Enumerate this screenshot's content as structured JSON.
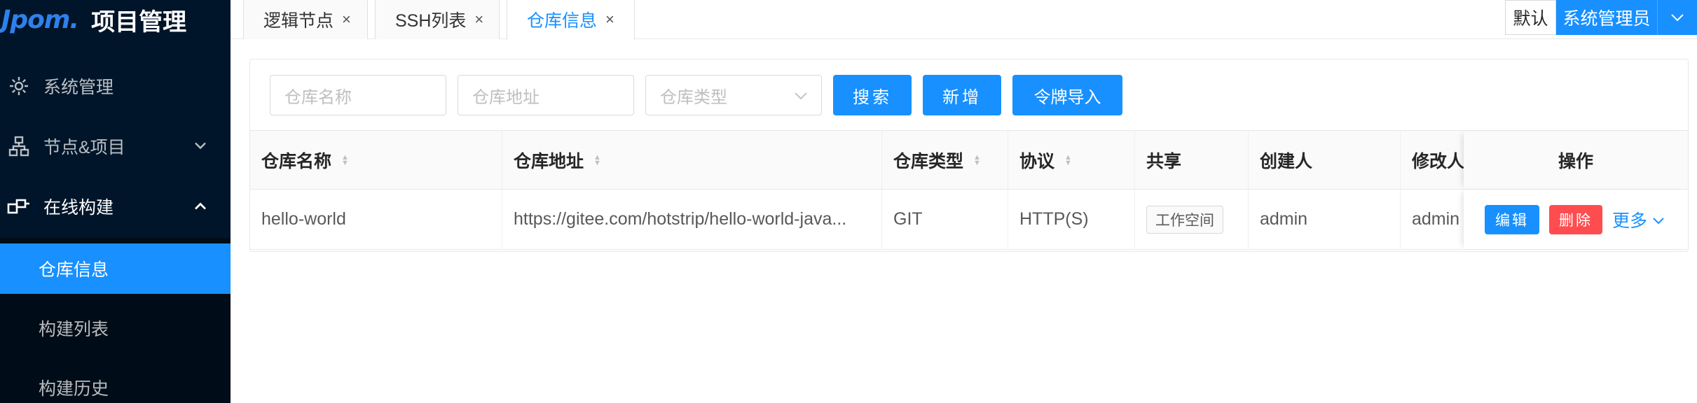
{
  "app": {
    "logo": "Jpom.",
    "title": "项目管理"
  },
  "sidebar": {
    "menu": [
      {
        "label": "系统管理",
        "icon": "gear-icon"
      },
      {
        "label": "节点&项目",
        "icon": "sitemap-icon",
        "arrow": "chevron-down-icon"
      },
      {
        "label": "在线构建",
        "icon": "build-icon",
        "arrow": "chevron-up-icon"
      }
    ],
    "submenu": [
      {
        "label": "仓库信息",
        "active": true
      },
      {
        "label": "构建列表"
      },
      {
        "label": "构建历史"
      }
    ]
  },
  "tabs": [
    {
      "label": "逻辑节点",
      "close": "×"
    },
    {
      "label": "SSH列表",
      "close": "×"
    },
    {
      "label": "仓库信息",
      "close": "×",
      "active": true
    }
  ],
  "user": {
    "workspace": "默认",
    "name": "系统管理员",
    "dropdown": "∨"
  },
  "filters": {
    "name_placeholder": "仓库名称",
    "url_placeholder": "仓库地址",
    "type_placeholder": "仓库类型",
    "search_label": "搜索",
    "add_label": "新增",
    "import_label": "令牌导入"
  },
  "table": {
    "columns": [
      "仓库名称",
      "仓库地址",
      "仓库类型",
      "协议",
      "共享",
      "创建人",
      "修改人",
      "操作"
    ],
    "rows": [
      {
        "name": "hello-world",
        "url": "https://gitee.com/hotstrip/hello-world-java...",
        "type": "GIT",
        "protocol": "HTTP(S)",
        "share": "工作空间",
        "creator": "admin",
        "modifier": "admin",
        "edit": "编辑",
        "delete": "删除",
        "more": "更多"
      }
    ]
  },
  "colors": {
    "primary": "#1890ff",
    "danger": "#ff4d4f",
    "sidebar": "#001529"
  }
}
